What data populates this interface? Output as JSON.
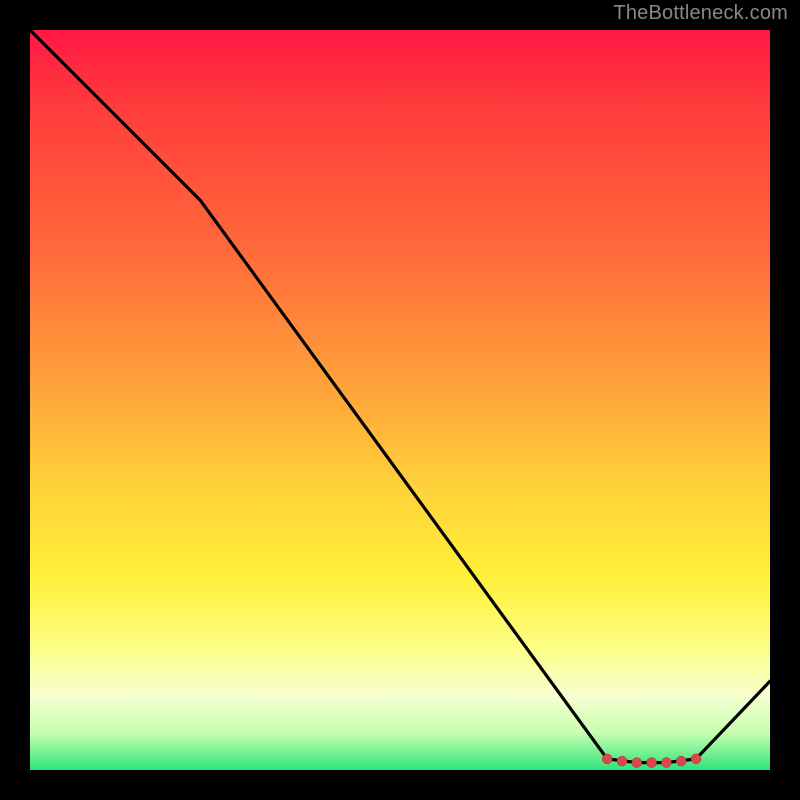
{
  "attribution": "TheBottleneck.com",
  "chart_data": {
    "type": "line",
    "title": "",
    "xlabel": "",
    "ylabel": "",
    "xlim": [
      0,
      100
    ],
    "ylim": [
      0,
      100
    ],
    "grid": false,
    "legend": false,
    "series": [
      {
        "name": "bottleneck-curve",
        "x": [
          0,
          23,
          78,
          82,
          86,
          90,
          100
        ],
        "values": [
          100,
          77,
          1.5,
          1,
          1,
          1.5,
          12
        ]
      }
    ],
    "markers": {
      "name": "optimal-range",
      "x": [
        78,
        80,
        82,
        84,
        86,
        88,
        90
      ],
      "values": [
        1.5,
        1.2,
        1,
        1,
        1,
        1.2,
        1.5
      ]
    }
  }
}
